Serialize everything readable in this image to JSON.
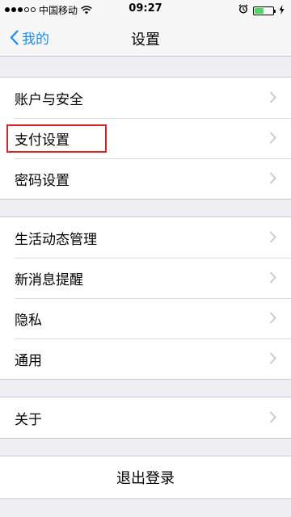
{
  "status_bar": {
    "carrier": "中国移动",
    "time": "09:27",
    "signal_dots_filled": 3,
    "signal_dots_total": 5,
    "battery_level": 0.5,
    "battery_color": "#4cd964",
    "icons": [
      "signal-icon",
      "wifi-icon",
      "alarm-icon",
      "battery-icon",
      "charging-bolt-icon"
    ]
  },
  "nav": {
    "back_label": "我的",
    "title": "设置",
    "accent_color": "#1a8cf0"
  },
  "groups": [
    {
      "items": [
        {
          "label": "账户与安全"
        },
        {
          "label": "支付设置",
          "highlighted": true
        },
        {
          "label": "密码设置"
        }
      ]
    },
    {
      "items": [
        {
          "label": "生活动态管理"
        },
        {
          "label": "新消息提醒"
        },
        {
          "label": "隐私"
        },
        {
          "label": "通用"
        }
      ]
    },
    {
      "items": [
        {
          "label": "关于"
        }
      ]
    }
  ],
  "logout": {
    "label": "退出登录"
  },
  "highlight_color": "#d9232a"
}
